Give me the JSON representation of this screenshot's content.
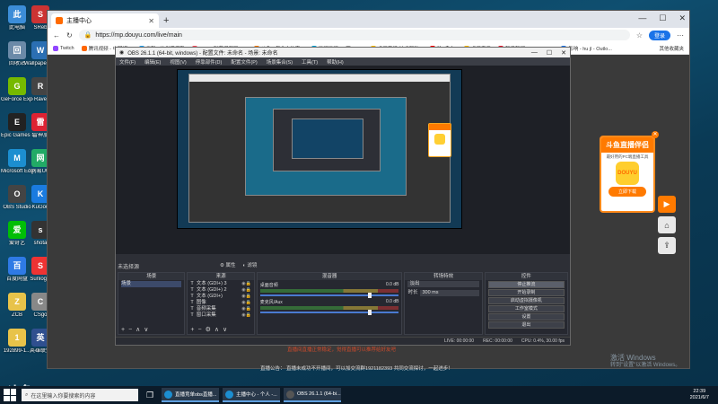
{
  "desktop": {
    "icons_left": [
      {
        "label": "此电脑",
        "color": "#3c8dd8"
      },
      {
        "label": "回收站",
        "color": "#6b8aa8"
      },
      {
        "label": "GeForce Experience",
        "color": "#76b900"
      },
      {
        "label": "Epic Games Launcher",
        "color": "#222222"
      },
      {
        "label": "Microsoft Edge",
        "color": "#1c8ed0"
      },
      {
        "label": "OBS Studio",
        "color": "#444444"
      },
      {
        "label": "爱奇艺",
        "color": "#00be06"
      },
      {
        "label": "百度网盘",
        "color": "#2f7ae5"
      },
      {
        "label": "ZCB",
        "color": "#e8c34a"
      },
      {
        "label": "192899-1...",
        "color": "#e8c34a"
      }
    ],
    "icons_right": [
      {
        "label": "SReb",
        "color": "#c33"
      },
      {
        "label": "Wallpaper Engine",
        "color": "#2b6fb3"
      },
      {
        "label": "Rave",
        "color": "#444"
      },
      {
        "label": "雷神加",
        "color": "#d23"
      },
      {
        "label": "网易UU",
        "color": "#2a6"
      },
      {
        "label": "KuGou",
        "color": "#1a7be0"
      },
      {
        "label": "shota",
        "color": "#333"
      },
      {
        "label": "Sunlogin",
        "color": "#e33"
      },
      {
        "label": "CSgo",
        "color": "#888"
      },
      {
        "label": "英雄联盟",
        "color": "#2f4f8f"
      }
    ]
  },
  "browser": {
    "tab_title": "主播中心",
    "url": "https://mp.douyu.com/live/main",
    "login_label": "登录",
    "bookmarks": [
      {
        "label": "Twitch",
        "color": "#9146ff"
      },
      {
        "label": "腾讯视频 - 中国视...",
        "color": "#ff6600"
      },
      {
        "label": "优酷 - 这世界很酷",
        "color": "#1ea1f2"
      },
      {
        "label": "AcFun弹幕视频网 - ...",
        "color": "#fd4c5c"
      },
      {
        "label": "斗鱼 - 每个人的直...",
        "color": "#ff7a00"
      },
      {
        "label": "哔哩哔哩",
        "color": "#00a1d6"
      },
      {
        "label": "\"つ...",
        "color": "#999999"
      },
      {
        "label": "虎牙直播-技术驱动...",
        "color": "#ffbb00"
      },
      {
        "label": "YouTube",
        "color": "#ff0000"
      },
      {
        "label": "虎牙音乐",
        "color": "#ffbb00"
      },
      {
        "label": "新浪新闻 - LCG - LS...",
        "color": "#e6162d"
      },
      {
        "label": "影响 - hu jl - Outlo...",
        "color": "#1a73e8"
      }
    ],
    "other_bookmarks": "其他收藏夹"
  },
  "obs": {
    "title": "OBS 26.1.1 (64-bit, windows) - 配置文件: 未命名 - 场景: 未命名",
    "menu": [
      "文件(F)",
      "编辑(E)",
      "视图(V)",
      "停靠部件(D)",
      "配置文件(P)",
      "场景集合(S)",
      "工具(T)",
      "帮助(H)"
    ],
    "no_source": "未选择源",
    "properties": "属性",
    "filters": "滤镜",
    "panels": {
      "scenes": {
        "header": "场景",
        "items": [
          "场景"
        ]
      },
      "sources": {
        "header": "来源",
        "items": [
          "文本 (GDI+) 3",
          "文本 (GDI+) 2",
          "文本 (GDI+)",
          "图像",
          "音频采集",
          "窗口采集"
        ]
      },
      "mixer": {
        "header": "混音器",
        "channels": [
          {
            "name": "桌面音频",
            "level": "0.0 dB"
          },
          {
            "name": "麦克风/Aux",
            "level": "0.0 dB"
          }
        ]
      },
      "transitions": {
        "header": "转场特效",
        "type": "淡出",
        "duration_label": "时长",
        "duration": "300 ms"
      },
      "controls": {
        "header": "控件",
        "buttons": [
          "停止推流",
          "开始录制",
          "启动虚拟摄像机",
          "工作室模式",
          "设置",
          "退出"
        ]
      }
    },
    "status": {
      "live": "LIVE: 00:00:00",
      "rec": "REC: 00:00:00",
      "cpu": "CPU: 0.4%, 30.00 fps"
    }
  },
  "page_notice_1": "直播间直播正常稳定，觉得直播可以推荐给好友吧",
  "page_notice_2": "直播公告：   直播未成功不开播间，可以加交流群1921182393 共同交流探讨，一起进步！",
  "promo": {
    "title": "斗鱼直播伴侣",
    "subtitle": "最好用的PC端直播工具",
    "logo_text": "DOUYU",
    "button": "立即下载"
  },
  "watermark": {
    "line1": "激活 Windows",
    "line2": "转到\"设置\"以激活 Windows。"
  },
  "corner_logo": "斗鱼",
  "taskbar": {
    "search_placeholder": "在这里输入你要搜索的内容",
    "apps": [
      {
        "label": "直播竞单obs直播...",
        "color": "#1c8ed0"
      },
      {
        "label": "主播中心 - 个人 -...",
        "color": "#1c8ed0"
      },
      {
        "label": "OBS 26.1.1 (64-bi...",
        "color": "#555555"
      }
    ],
    "time": "22:39",
    "date": "2021/6/7"
  }
}
